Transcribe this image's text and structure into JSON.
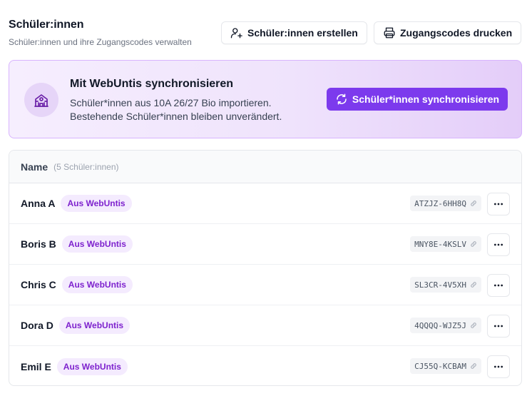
{
  "header": {
    "title": "Schüler:innen",
    "subtitle": "Schüler:innen und ihre Zugangscodes verwalten"
  },
  "actions": {
    "create_label": "Schüler:innen erstellen",
    "print_label": "Zugangscodes drucken"
  },
  "sync": {
    "title": "Mit WebUntis synchronisieren",
    "line1": "Schüler*innen aus 10A 26/27 Bio importieren.",
    "line2": "Bestehende Schüler*innen bleiben unverändert.",
    "button_label": "Schüler*innen synchronisieren"
  },
  "table": {
    "column_name": "Name",
    "count_label": "(5 Schüler:innen)",
    "rows": [
      {
        "name": "Anna A",
        "badge": "Aus WebUntis",
        "code": "ATZJZ-6HH8Q"
      },
      {
        "name": "Boris B",
        "badge": "Aus WebUntis",
        "code": "MNY8E-4KSLV"
      },
      {
        "name": "Chris C",
        "badge": "Aus WebUntis",
        "code": "SL3CR-4V5XH"
      },
      {
        "name": "Dora D",
        "badge": "Aus WebUntis",
        "code": "4QQQQ-WJZ5J"
      },
      {
        "name": "Emil E",
        "badge": "Aus WebUntis",
        "code": "CJ55Q-KCBAM"
      }
    ]
  },
  "icons": {
    "create": "user-plus-icon",
    "print": "printer-icon",
    "school": "school-icon",
    "sync": "refresh-icon",
    "link": "link-icon",
    "more": "more-horizontal-icon"
  },
  "colors": {
    "primary": "#7c3aed",
    "badge_text": "#7e22ce",
    "badge_bg": "#f4ebfe",
    "card_border": "#d8b4fe"
  }
}
